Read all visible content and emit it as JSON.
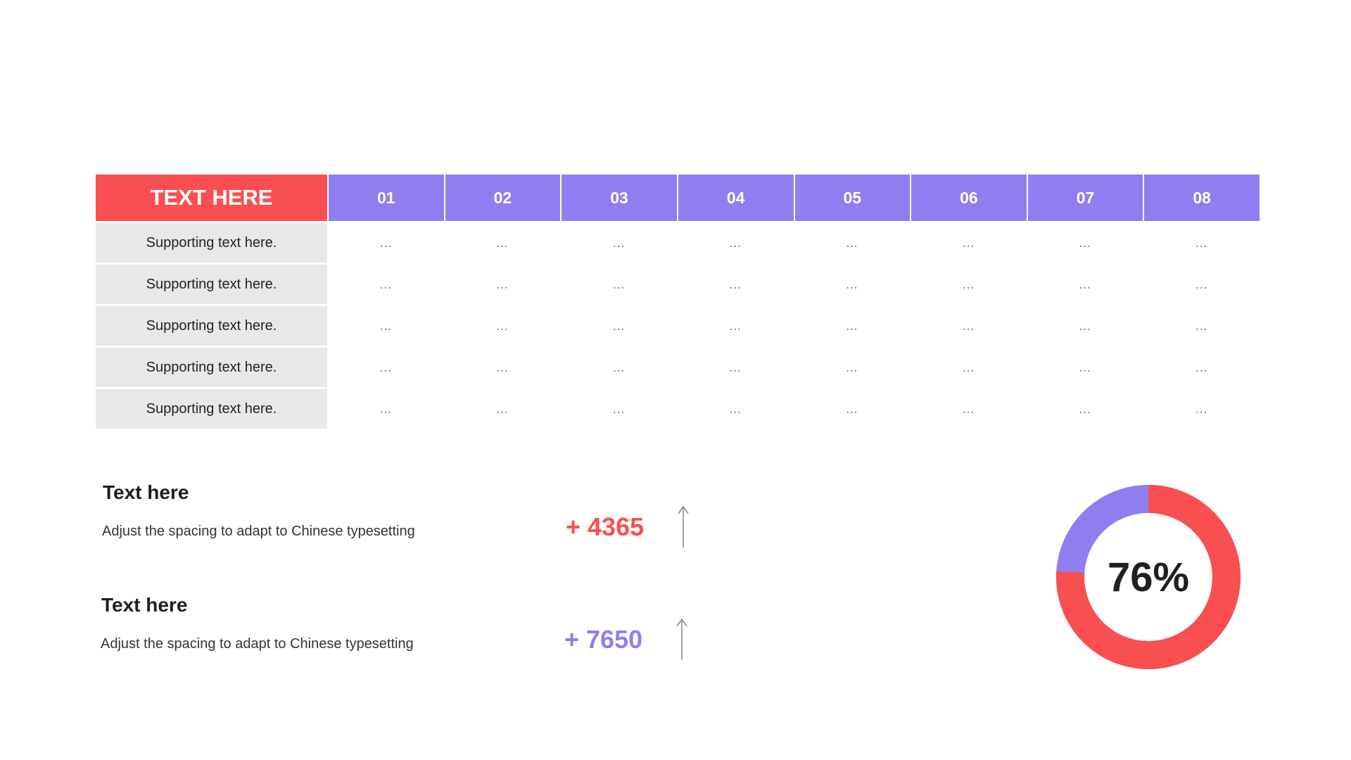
{
  "table": {
    "header_main": "TEXT HERE",
    "columns": [
      "01",
      "02",
      "03",
      "04",
      "05",
      "06",
      "07",
      "08"
    ],
    "rows": [
      {
        "label": "Supporting text here.",
        "cells": [
          "…",
          "…",
          "…",
          "…",
          "…",
          "…",
          "…",
          "…"
        ]
      },
      {
        "label": "Supporting text here.",
        "cells": [
          "…",
          "…",
          "…",
          "…",
          "…",
          "…",
          "…",
          "…"
        ]
      },
      {
        "label": "Supporting text here.",
        "cells": [
          "…",
          "…",
          "…",
          "…",
          "…",
          "…",
          "…",
          "…"
        ]
      },
      {
        "label": "Supporting text here.",
        "cells": [
          "…",
          "…",
          "…",
          "…",
          "…",
          "…",
          "…",
          "…"
        ]
      },
      {
        "label": "Supporting text here.",
        "cells": [
          "…",
          "…",
          "…",
          "…",
          "…",
          "…",
          "…",
          "…"
        ]
      }
    ]
  },
  "stats": [
    {
      "title": "Text here",
      "desc": "Adjust the spacing to adapt to Chinese typesetting",
      "value": "+ 4365",
      "color": "#f94f50",
      "icon": "arrow-up-icon"
    },
    {
      "title": "Text here",
      "desc": "Adjust the spacing to adapt to Chinese typesetting",
      "value": "+ 7650",
      "color": "#8f7ef0",
      "icon": "arrow-up-icon"
    }
  ],
  "donut": {
    "label": "76%",
    "percent": 76,
    "primary_color": "#f94f50",
    "secondary_color": "#8f7ef0"
  }
}
